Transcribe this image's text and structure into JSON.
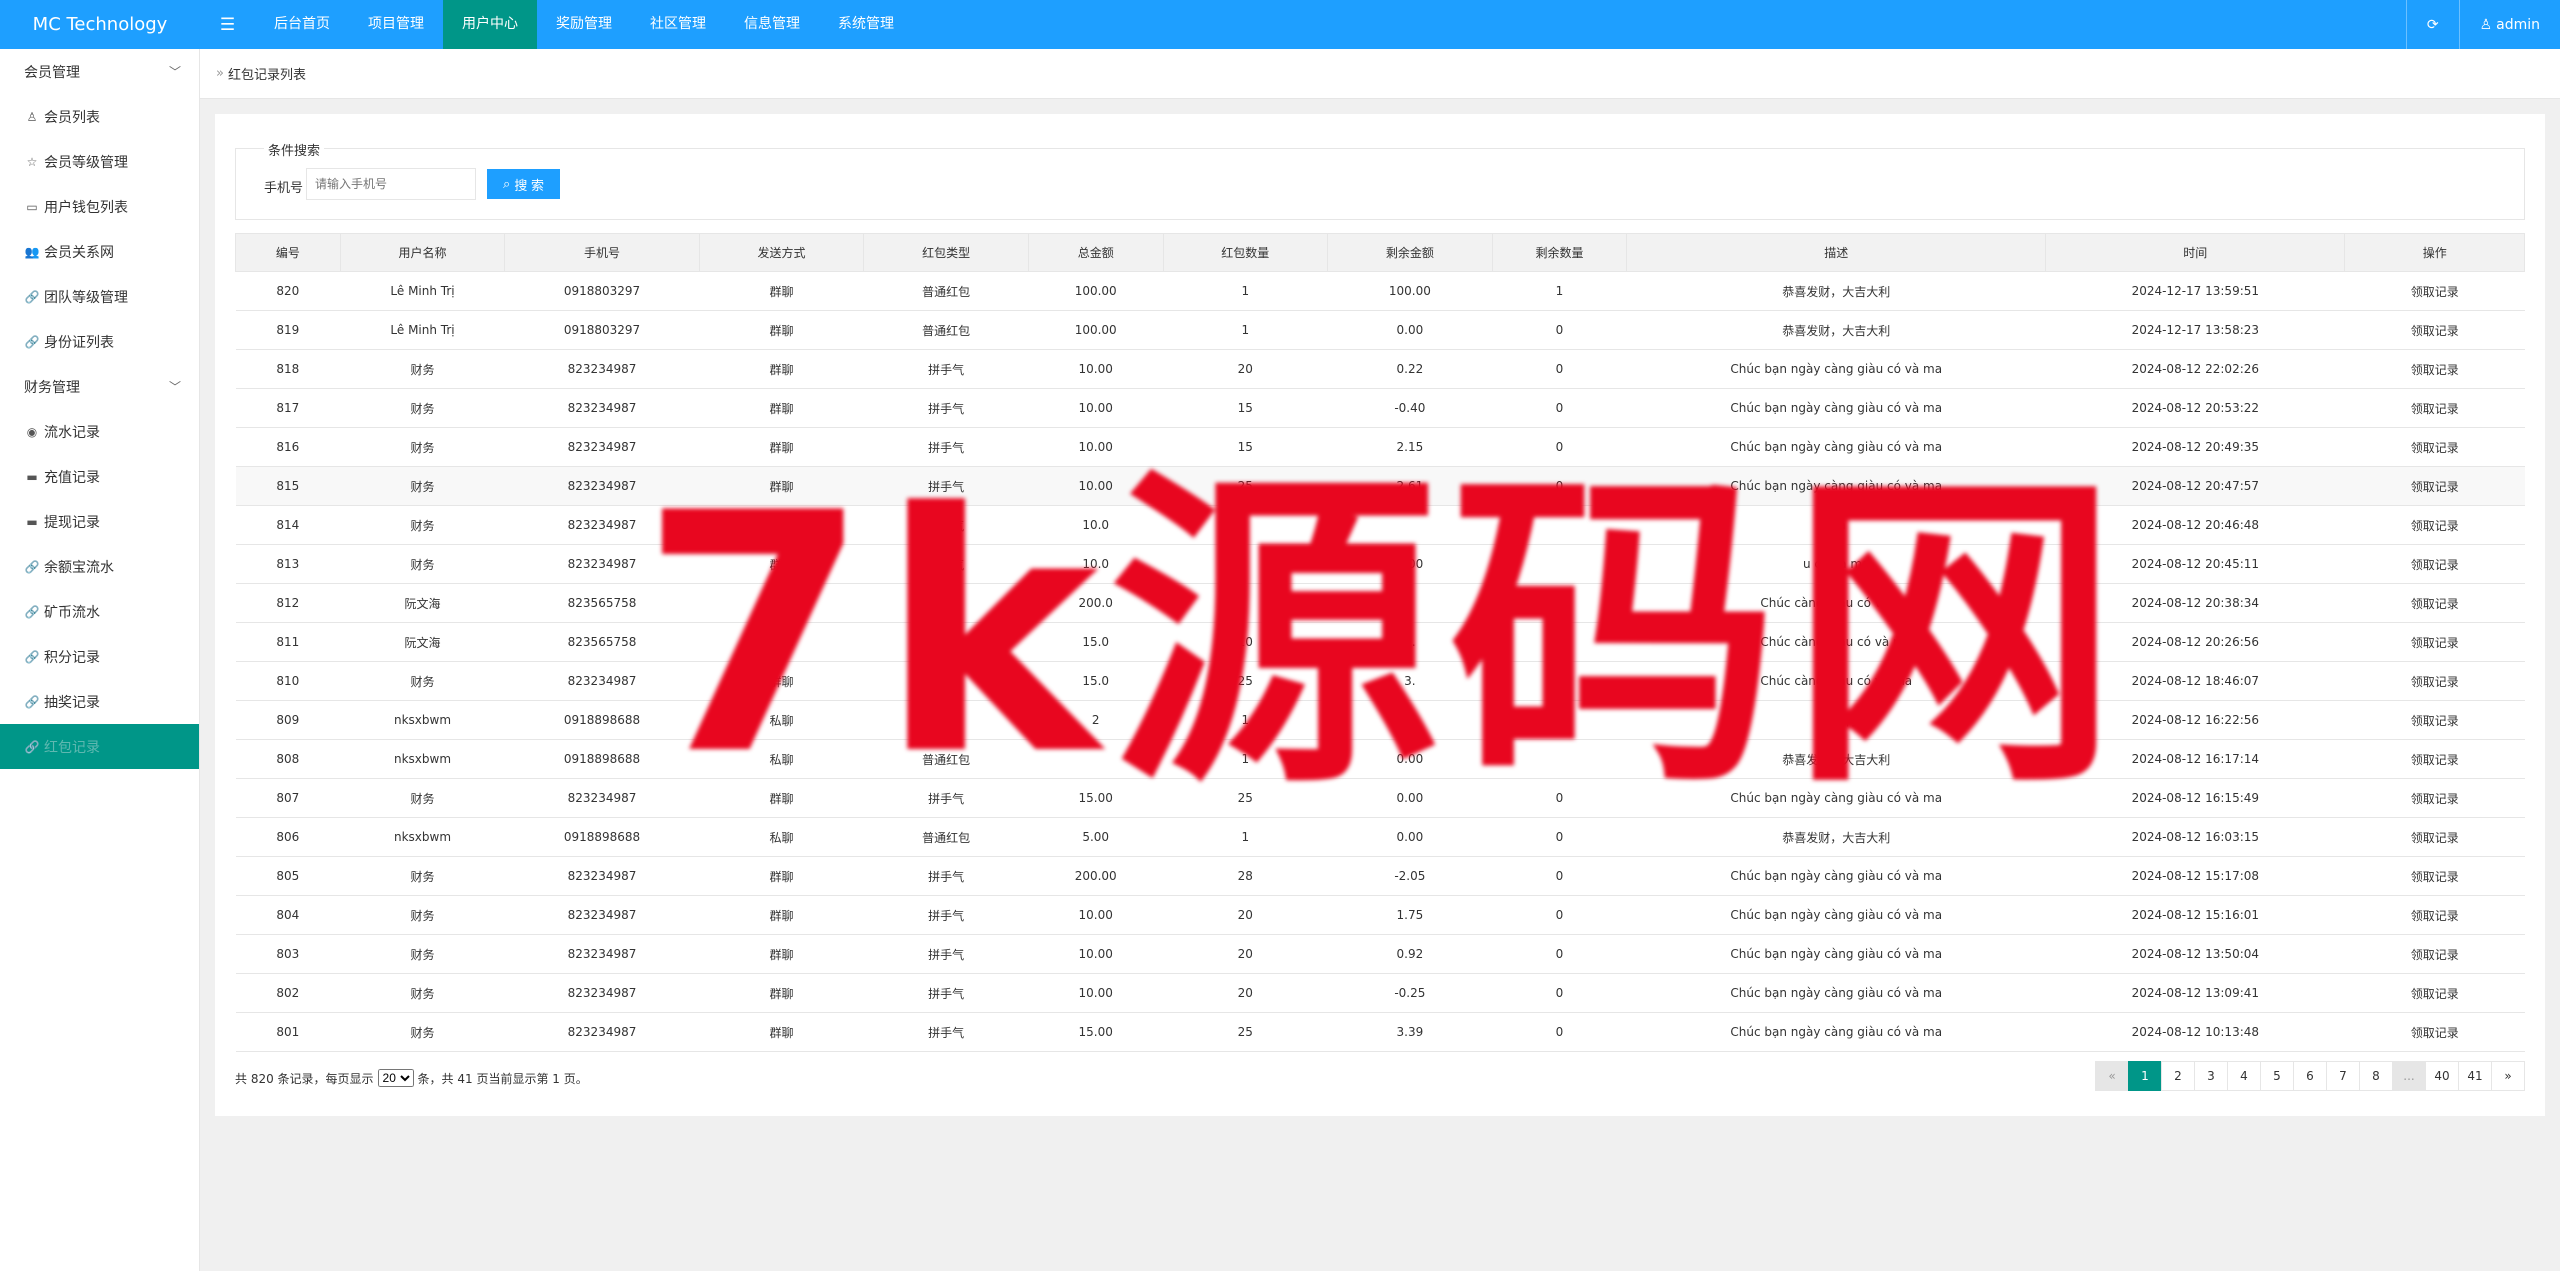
{
  "app": {
    "title": "MC Technology"
  },
  "top_nav": [
    "后台首页",
    "项目管理",
    "用户中心",
    "奖励管理",
    "社区管理",
    "信息管理",
    "系统管理"
  ],
  "top_right": {
    "user": "admin"
  },
  "sidebar": {
    "groups": [
      {
        "label": "会员管理",
        "items": [
          {
            "label": "会员列表",
            "icon": "user-icon"
          },
          {
            "label": "会员等级管理",
            "icon": "star-icon"
          },
          {
            "label": "用户钱包列表",
            "icon": "card-icon"
          },
          {
            "label": "会员关系网",
            "icon": "users-icon"
          },
          {
            "label": "团队等级管理",
            "icon": "link-icon"
          },
          {
            "label": "身份证列表",
            "icon": "link-icon"
          }
        ]
      },
      {
        "label": "财务管理",
        "items": [
          {
            "label": "流水记录",
            "icon": "coin-icon"
          },
          {
            "label": "充值记录",
            "icon": "card-icon"
          },
          {
            "label": "提现记录",
            "icon": "card-icon"
          },
          {
            "label": "余额宝流水",
            "icon": "link-icon"
          },
          {
            "label": "矿币流水",
            "icon": "link-icon"
          },
          {
            "label": "积分记录",
            "icon": "link-icon"
          },
          {
            "label": "抽奖记录",
            "icon": "link-icon"
          },
          {
            "label": "红包记录",
            "icon": "link-icon"
          }
        ]
      }
    ]
  },
  "breadcrumb": "红包记录列表",
  "search": {
    "legend": "条件搜索",
    "label": "手机号",
    "placeholder": "请输入手机号",
    "button": "搜 索"
  },
  "table": {
    "columns": [
      "编号",
      "用户名称",
      "手机号",
      "发送方式",
      "红包类型",
      "总金额",
      "红包数量",
      "剩余金额",
      "剩余数量",
      "描述",
      "时间",
      "操作"
    ],
    "rows": [
      [
        "820",
        "Lê Minh Trị",
        "0918803297",
        "群聊",
        "普通红包",
        "100.00",
        "1",
        "100.00",
        "1",
        "恭喜发财，大吉大利",
        "2024-12-17 13:59:51",
        "领取记录"
      ],
      [
        "819",
        "Lê Minh Trị",
        "0918803297",
        "群聊",
        "普通红包",
        "100.00",
        "1",
        "0.00",
        "0",
        "恭喜发财，大吉大利",
        "2024-12-17 13:58:23",
        "领取记录"
      ],
      [
        "818",
        "财务",
        "823234987",
        "群聊",
        "拼手气",
        "10.00",
        "20",
        "0.22",
        "0",
        "Chúc bạn ngày càng giàu có và ma",
        "2024-08-12 22:02:26",
        "领取记录"
      ],
      [
        "817",
        "财务",
        "823234987",
        "群聊",
        "拼手气",
        "10.00",
        "15",
        "-0.40",
        "0",
        "Chúc bạn ngày càng giàu có và ma",
        "2024-08-12 20:53:22",
        "领取记录"
      ],
      [
        "816",
        "财务",
        "823234987",
        "群聊",
        "拼手气",
        "10.00",
        "15",
        "2.15",
        "0",
        "Chúc bạn ngày càng giàu có và ma",
        "2024-08-12 20:49:35",
        "领取记录"
      ],
      [
        "815",
        "财务",
        "823234987",
        "群聊",
        "拼手气",
        "10.00",
        "25",
        "2.61",
        "0",
        "Chúc bạn ngày càng giàu có và ma",
        "2024-08-12 20:47:57",
        "领取记录"
      ],
      [
        "814",
        "财务",
        "823234987",
        "群聊",
        "拼手气",
        "10.0",
        "",
        "",
        "",
        "ma",
        "2024-08-12 20:46:48",
        "领取记录"
      ],
      [
        "813",
        "财务",
        "823234987",
        "群聊",
        "拼手气",
        "10.0",
        "",
        "0.00",
        "",
        "u có và ma",
        "2024-08-12 20:45:11",
        "领取记录"
      ],
      [
        "812",
        "阮文海",
        "823565758",
        "群聊",
        "",
        "200.0",
        "",
        "",
        "",
        "Chúc càng giàu có và ma",
        "2024-08-12 20:38:34",
        "领取记录"
      ],
      [
        "811",
        "阮文海",
        "823565758",
        "群聊",
        "",
        "15.0",
        "10",
        "0.",
        "",
        "Chúc càng giàu có và ma",
        "2024-08-12 20:26:56",
        "领取记录"
      ],
      [
        "810",
        "财务",
        "823234987",
        "群聊",
        "",
        "15.0",
        "25",
        "3.",
        "0",
        "Chúc càng giàu có và ma",
        "2024-08-12 18:46:07",
        "领取记录"
      ],
      [
        "809",
        "nksxbwm",
        "0918898688",
        "私聊",
        "普通",
        "2",
        "1",
        "0",
        "0",
        "恭喜 利",
        "2024-08-12 16:22:56",
        "领取记录"
      ],
      [
        "808",
        "nksxbwm",
        "0918898688",
        "私聊",
        "普通红包",
        "",
        "1",
        "0.00",
        "",
        "恭喜发财，大吉大利",
        "2024-08-12 16:17:14",
        "领取记录"
      ],
      [
        "807",
        "财务",
        "823234987",
        "群聊",
        "拼手气",
        "15.00",
        "25",
        "0.00",
        "0",
        "Chúc bạn ngày càng giàu có và ma",
        "2024-08-12 16:15:49",
        "领取记录"
      ],
      [
        "806",
        "nksxbwm",
        "0918898688",
        "私聊",
        "普通红包",
        "5.00",
        "1",
        "0.00",
        "0",
        "恭喜发财，大吉大利",
        "2024-08-12 16:03:15",
        "领取记录"
      ],
      [
        "805",
        "财务",
        "823234987",
        "群聊",
        "拼手气",
        "200.00",
        "28",
        "-2.05",
        "0",
        "Chúc bạn ngày càng giàu có và ma",
        "2024-08-12 15:17:08",
        "领取记录"
      ],
      [
        "804",
        "财务",
        "823234987",
        "群聊",
        "拼手气",
        "10.00",
        "20",
        "1.75",
        "0",
        "Chúc bạn ngày càng giàu có và ma",
        "2024-08-12 15:16:01",
        "领取记录"
      ],
      [
        "803",
        "财务",
        "823234987",
        "群聊",
        "拼手气",
        "10.00",
        "20",
        "0.92",
        "0",
        "Chúc bạn ngày càng giàu có và ma",
        "2024-08-12 13:50:04",
        "领取记录"
      ],
      [
        "802",
        "财务",
        "823234987",
        "群聊",
        "拼手气",
        "10.00",
        "20",
        "-0.25",
        "0",
        "Chúc bạn ngày càng giàu có và ma",
        "2024-08-12 13:09:41",
        "领取记录"
      ],
      [
        "801",
        "财务",
        "823234987",
        "群聊",
        "拼手气",
        "15.00",
        "25",
        "3.39",
        "0",
        "Chúc bạn ngày càng giàu có và ma",
        "2024-08-12 10:13:48",
        "领取记录"
      ]
    ]
  },
  "footer": {
    "prefix": "共 820 条记录，每页显示",
    "page_size": "20",
    "suffix": "条，共 41 页当前显示第 1 页。"
  },
  "pagination": [
    "«",
    "1",
    "2",
    "3",
    "4",
    "5",
    "6",
    "7",
    "8",
    "...",
    "40",
    "41",
    "»"
  ],
  "watermark": "7k源码网",
  "colors": {
    "topbar": "#1e9fff",
    "accent": "#009688",
    "watermark": "#e8061f"
  }
}
